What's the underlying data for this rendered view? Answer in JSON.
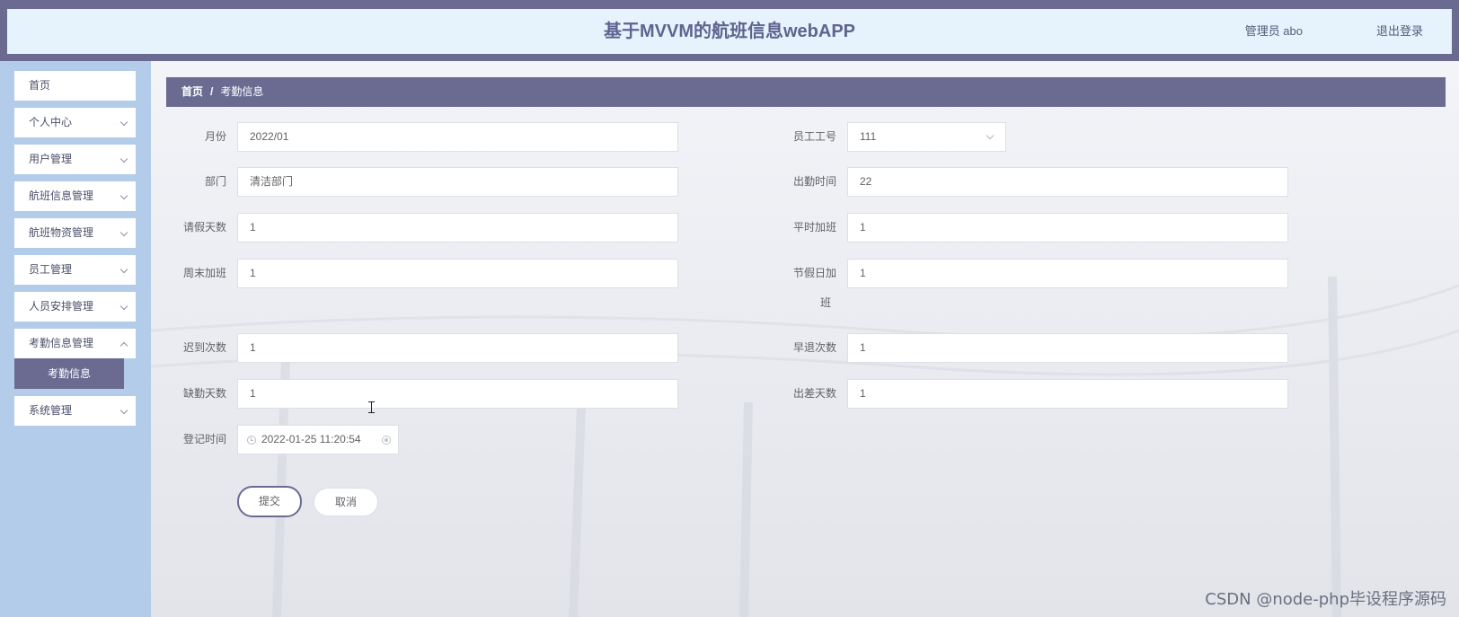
{
  "header": {
    "title": "基于MVVM的航班信息webAPP",
    "user": "管理员 abo",
    "logout": "退出登录"
  },
  "sidebar": {
    "items": [
      {
        "label": "首页"
      },
      {
        "label": "个人中心"
      },
      {
        "label": "用户管理"
      },
      {
        "label": "航班信息管理"
      },
      {
        "label": "航班物资管理"
      },
      {
        "label": "员工管理"
      },
      {
        "label": "人员安排管理"
      },
      {
        "label": "考勤信息管理"
      },
      {
        "label": "系统管理"
      }
    ],
    "active_sub": "考勤信息"
  },
  "breadcrumb": {
    "home": "首页",
    "separator": "/",
    "current": "考勤信息"
  },
  "form": {
    "month": {
      "label": "月份",
      "value": "2022/01"
    },
    "employee_no": {
      "label": "员工工号",
      "value": "111"
    },
    "department": {
      "label": "部门",
      "value": "清洁部门"
    },
    "attendance_time": {
      "label": "出勤时间",
      "value": "22"
    },
    "leave_days": {
      "label": "请假天数",
      "value": "1"
    },
    "weekday_overtime": {
      "label": "平时加班",
      "value": "1"
    },
    "weekend_overtime": {
      "label": "周末加班",
      "value": "1"
    },
    "holiday_overtime": {
      "label_line1": "节假日加",
      "label_line2": "班",
      "value": "1"
    },
    "late_count": {
      "label": "迟到次数",
      "value": "1"
    },
    "early_leave_count": {
      "label": "早退次数",
      "value": "1"
    },
    "absence_days": {
      "label": "缺勤天数",
      "value": "1"
    },
    "business_trip_days": {
      "label": "出差天数",
      "value": "1"
    },
    "register_time": {
      "label": "登记时间",
      "value": "2022-01-25 11:20:54"
    }
  },
  "buttons": {
    "submit": "提交",
    "cancel": "取消"
  },
  "watermark": "CSDN @node-php毕设程序源码",
  "colors": {
    "accent": "#6b6b92",
    "sidebar_bg": "#b3cce9",
    "header_bg": "#e7f3fc"
  }
}
